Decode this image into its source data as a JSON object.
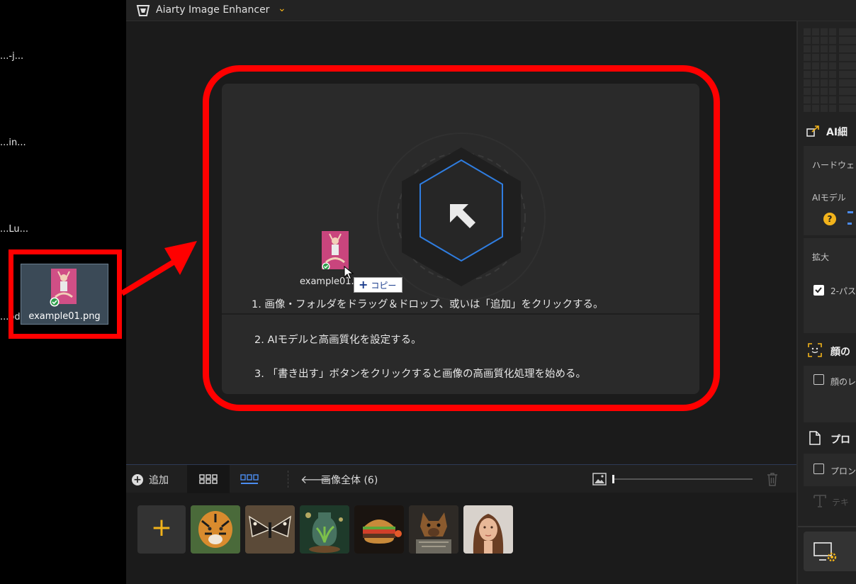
{
  "desktop": {
    "labels": [
      "...-j...",
      "...in...",
      "...Lu...",
      "...od"
    ],
    "file_name": "example01.png"
  },
  "app": {
    "title": "Aiarty Image Enhancer",
    "chevron": "⌄"
  },
  "dropzone": {
    "step1": "1. 画像・フォルダをドラッグ＆ドロップ、或いは「追加」をクリックする。",
    "step2": "2. AIモデルと高画質化を設定する。",
    "step3": "3. 「書き出す」ボタンをクリックすると画像の高画質化処理を始める。",
    "drag_name": "example01.",
    "copy_label": "コピー",
    "copy_plus": "+"
  },
  "bottombar": {
    "add_label": "追加",
    "add_plus": "+",
    "back_arrow": "🡐",
    "all_images": "画像全体 (6)",
    "zoom_level": 0
  },
  "thumbnails": {
    "add_plus": "+",
    "items": [
      "tiger",
      "butterfly",
      "bottle-plant",
      "burger",
      "dog-armor",
      "woman-portrait"
    ]
  },
  "rightpanel": {
    "ai_heading": "AI細",
    "hardware": "ハードウェ",
    "ai_model": "AIモデル",
    "help": "?",
    "upscale": "拡大",
    "two_pass": "2-パス",
    "face_heading": "顔の",
    "face_option": "顔のレ",
    "prompt_heading": "プロ",
    "prompt_option": "プロン",
    "text_label": "テキ"
  },
  "colors": {
    "accent": "#f2b31b",
    "highlight_red": "#ff0000",
    "hex_blue": "#2f7de0"
  }
}
